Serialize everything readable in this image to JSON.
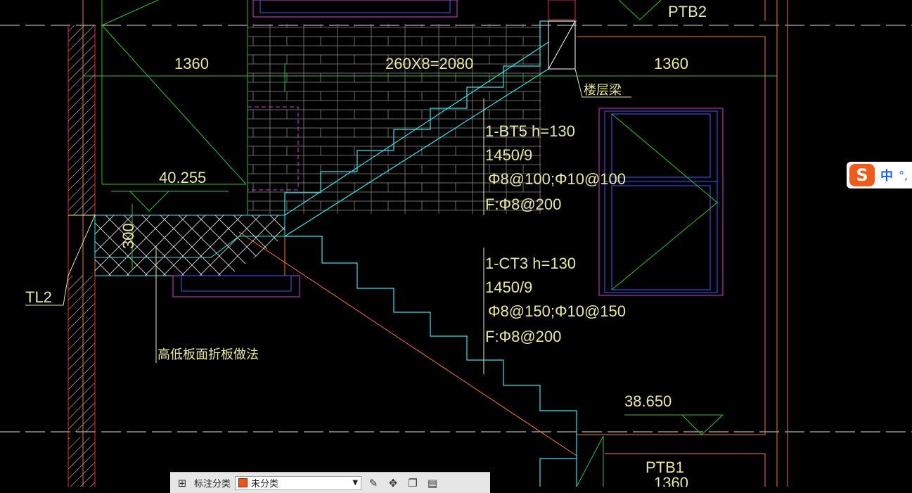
{
  "drawing": {
    "dim_left": "1360",
    "dim_right": "1360",
    "dim_steps": "260X8=2080",
    "label_ptb2": "PTB2",
    "label_ptb1": "PTB1",
    "label_ptb1_dim": "1360",
    "label_floor_beam": "楼层梁",
    "elev_upper": "40.255",
    "elev_lower": "38.650",
    "label_tl2": "TL2",
    "label_300": "300",
    "label_fold_note": "高低板面折板做法",
    "bt5": {
      "line1": "1-BT5  h=130",
      "line2": "1450/9",
      "line3": "Φ8@100;Φ10@100",
      "line4": "F:Φ8@200"
    },
    "ct3": {
      "line1": "1-CT3  h=130",
      "line2": "1450/9",
      "line3": "Φ8@150;Φ10@150",
      "line4": "F:Φ8@200"
    }
  },
  "ime": {
    "logo": "S",
    "mode": "中",
    "punct": "°,"
  },
  "toolbar": {
    "category_label": "标注分类",
    "category_value": "未分类"
  },
  "colors": {
    "cyan": "#3ee0e6",
    "white": "#ffffff",
    "orange": "#f07a3a",
    "red": "#e03030",
    "magenta": "#d040d0",
    "blue": "#4060ff",
    "green": "#30c030",
    "yellow": "#e8e8a0",
    "gray": "#b0b0b0"
  }
}
